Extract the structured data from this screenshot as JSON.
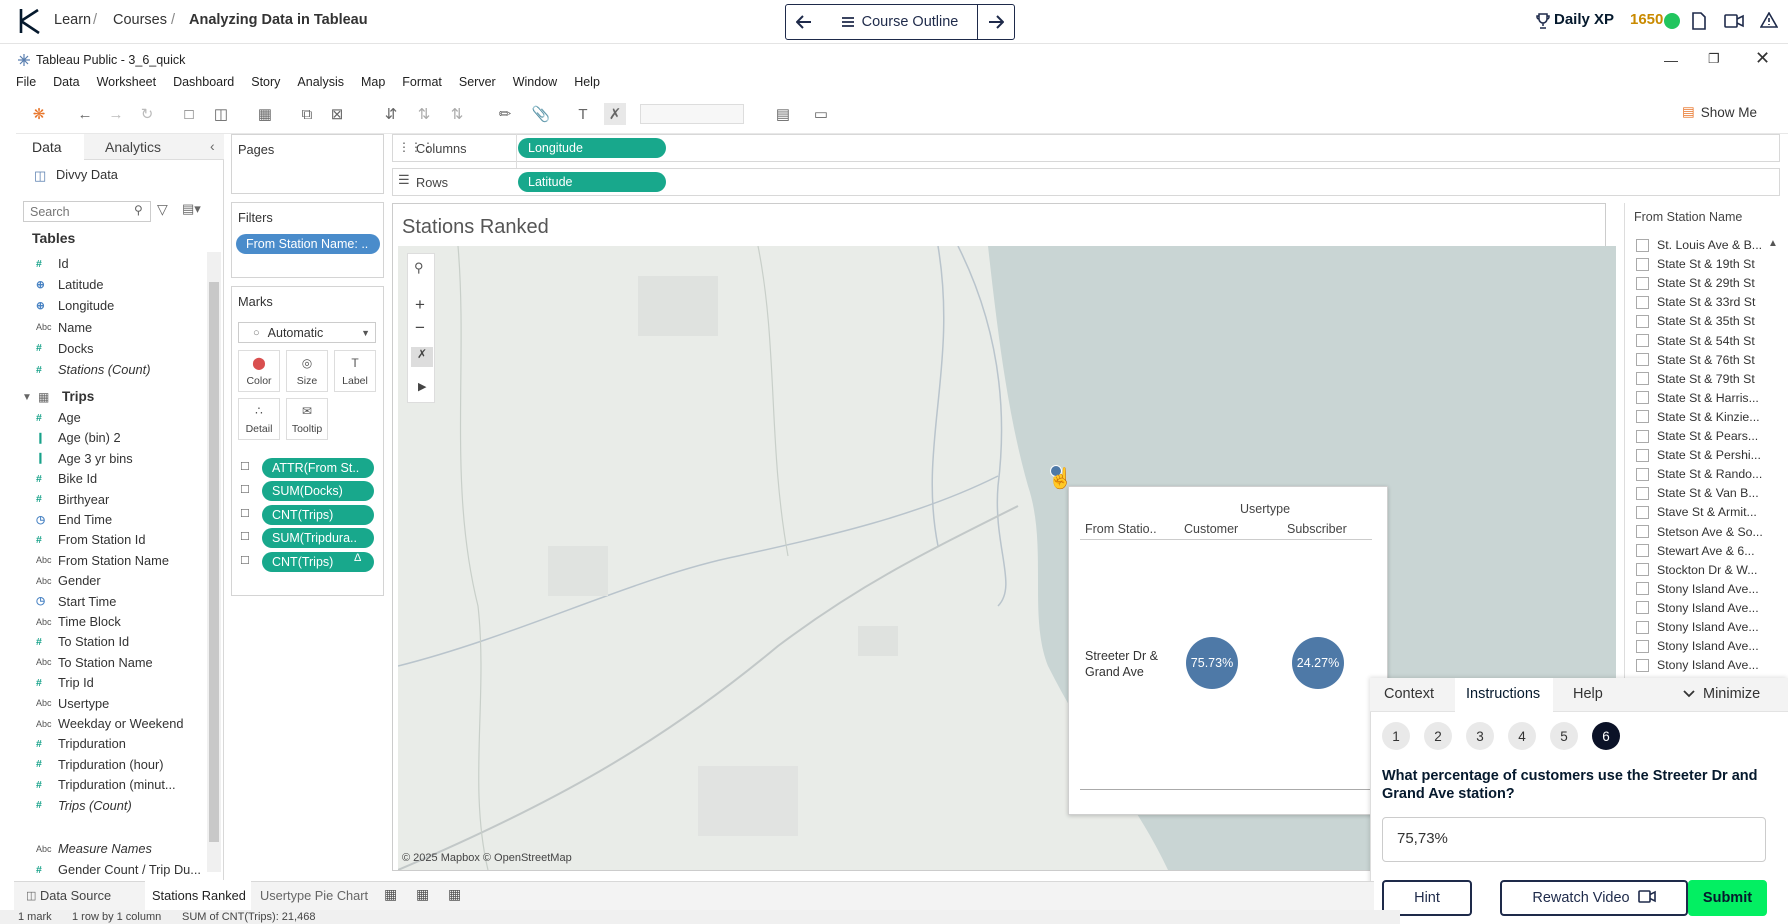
{
  "topbar": {
    "breadcrumb": [
      "Learn",
      "Courses",
      "Analyzing Data in Tableau"
    ],
    "separator": "/",
    "prev_icon": "arrow-left-icon",
    "next_icon": "arrow-right-icon",
    "course_outline_label": "Course Outline",
    "xp_label": "Daily XP",
    "xp_value": "1650",
    "xp_color": "#f5b800",
    "status_color": "#22c55e"
  },
  "tableau": {
    "window_title": "Tableau Public - 3_6_quick",
    "menu": [
      "File",
      "Data",
      "Worksheet",
      "Dashboard",
      "Story",
      "Analysis",
      "Map",
      "Format",
      "Server",
      "Window",
      "Help"
    ],
    "show_me": "Show Me",
    "data_pane": {
      "tabs": [
        "Data",
        "Analytics"
      ],
      "datasource": "Divvy Data",
      "search_placeholder": "Search",
      "tables_label": "Tables",
      "stations_fields": [
        {
          "name": "Id",
          "type": "measure"
        },
        {
          "name": "Latitude",
          "type": "geo"
        },
        {
          "name": "Longitude",
          "type": "geo"
        },
        {
          "name": "Name",
          "type": "string"
        },
        {
          "name": "Docks",
          "type": "measure"
        },
        {
          "name": "Stations (Count)",
          "type": "measure"
        }
      ],
      "trips_table": "Trips",
      "trips_fields": [
        {
          "name": "Age",
          "type": "measure"
        },
        {
          "name": "Age (bin) 2",
          "type": "bin"
        },
        {
          "name": "Age 3 yr bins",
          "type": "bin"
        },
        {
          "name": "Bike Id",
          "type": "measure"
        },
        {
          "name": "Birthyear",
          "type": "measure"
        },
        {
          "name": "End Time",
          "type": "date"
        },
        {
          "name": "From Station Id",
          "type": "measure"
        },
        {
          "name": "From Station Name",
          "type": "string"
        },
        {
          "name": "Gender",
          "type": "string"
        },
        {
          "name": "Start Time",
          "type": "date"
        },
        {
          "name": "Time Block",
          "type": "string"
        },
        {
          "name": "To Station Id",
          "type": "measure"
        },
        {
          "name": "To Station Name",
          "type": "string"
        },
        {
          "name": "Trip Id",
          "type": "measure"
        },
        {
          "name": "Usertype",
          "type": "string"
        },
        {
          "name": "Weekday or Weekend",
          "type": "string"
        },
        {
          "name": "Tripduration",
          "type": "measure"
        },
        {
          "name": "Tripduration (hour)",
          "type": "measure"
        },
        {
          "name": "Tripduration (minut...",
          "type": "measure"
        },
        {
          "name": "Trips (Count)",
          "type": "measure"
        }
      ],
      "measure_names": "Measure Names",
      "last_field": "Gender Count / Trip Du..."
    },
    "pages_label": "Pages",
    "filters_label": "Filters",
    "filter_pill": "From Station Name: ..",
    "marks": {
      "label": "Marks",
      "type": "Automatic",
      "buttons": [
        "Color",
        "Size",
        "Label",
        "Detail",
        "Tooltip"
      ],
      "pills": [
        "ATTR(From St..",
        "SUM(Docks)",
        "CNT(Trips)",
        "SUM(Tripdura..",
        "CNT(Trips)"
      ]
    },
    "columns_label": "Columns",
    "columns_pill": "Longitude",
    "rows_label": "Rows",
    "rows_pill": "Latitude",
    "viz_title": "Stations Ranked",
    "map_credit": "© 2025 Mapbox © OpenStreetMap",
    "legend": {
      "title": "From Station Name",
      "items": [
        "St. Louis Ave & B...",
        "State St & 19th St",
        "State St & 29th St",
        "State St & 33rd St",
        "State St & 35th St",
        "State St & 54th St",
        "State St & 76th St",
        "State St & 79th St",
        "State St & Harris...",
        "State St & Kinzie...",
        "State St & Pears...",
        "State St & Pershi...",
        "State St & Rando...",
        "State St & Van B...",
        "Stave St & Armit...",
        "Stetson Ave & So...",
        "Stewart Ave & 6...",
        "Stockton Dr & W...",
        "Stony Island Ave...",
        "Stony Island Ave...",
        "Stony Island Ave...",
        "Stony Island Ave...",
        "Stony Island Ave..."
      ]
    },
    "tooltip": {
      "header": "Usertype",
      "col1": "From Statio..",
      "col2": "Customer",
      "col3": "Subscriber",
      "station": "Streeter Dr & Grand Ave",
      "customer_pct": "75.73%",
      "subscriber_pct": "24.27%",
      "pie_color": "#4e79a7"
    },
    "sheet_tabs": [
      "Data Source",
      "Stations Ranked",
      "Usertype Pie Chart"
    ],
    "status": [
      "1 mark",
      "1 row by 1 column",
      "SUM of CNT(Trips): 21,468"
    ]
  },
  "instructions": {
    "tabs": [
      "Context",
      "Instructions",
      "Help"
    ],
    "minimize": "Minimize",
    "steps": [
      "1",
      "2",
      "3",
      "4",
      "5",
      "6"
    ],
    "question": "What percentage of customers use the Streeter Dr and Grand Ave station?",
    "answer": "75,73%",
    "hint": "Hint",
    "rewatch": "Rewatch Video",
    "submit": "Submit",
    "submit_color": "#03ef62"
  }
}
